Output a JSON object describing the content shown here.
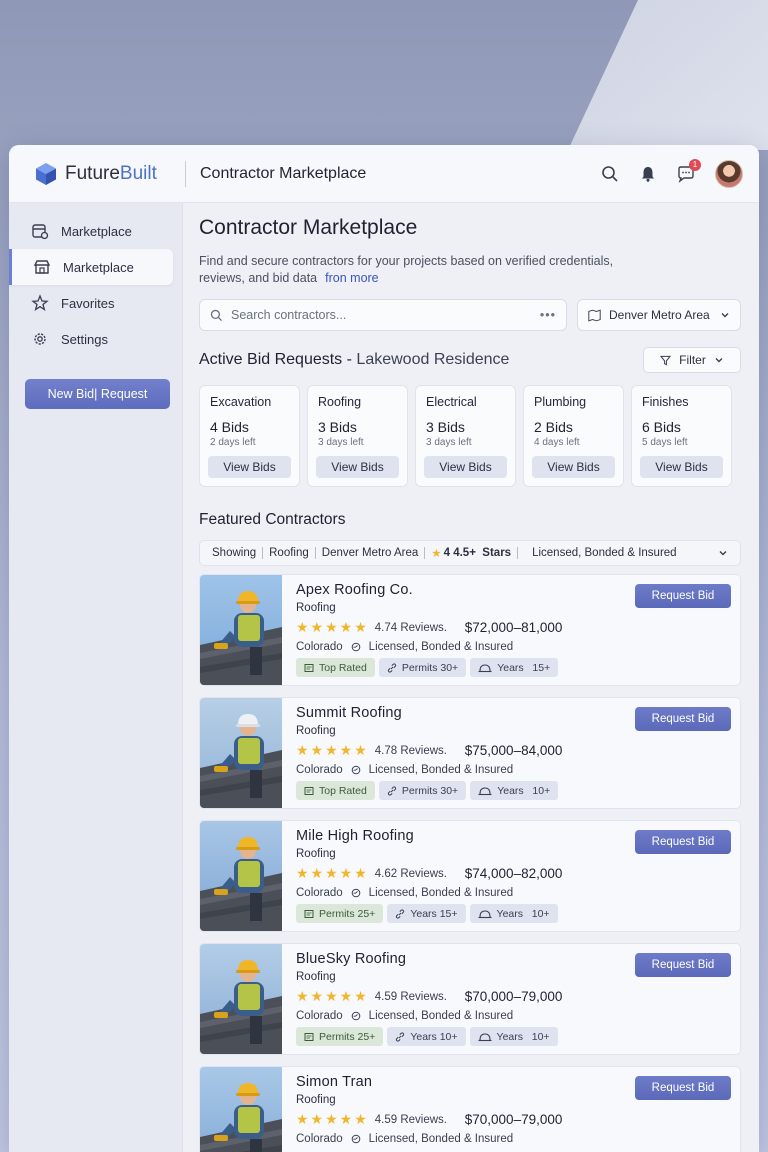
{
  "brand": {
    "name_part1": "Future",
    "name_part2": "Built"
  },
  "header": {
    "title": "Contractor Marketplace",
    "notification_count": "1"
  },
  "sidebar": {
    "items": [
      {
        "label": "Marketplace",
        "icon": "marketplace-icon",
        "active": false
      },
      {
        "label": "Marketplace",
        "icon": "store-icon",
        "active": true
      },
      {
        "label": "Favorites",
        "icon": "star-icon",
        "active": false
      },
      {
        "label": "Settings",
        "icon": "gear-icon",
        "active": false
      }
    ],
    "new_button": "New Bid| Request"
  },
  "main": {
    "title": "Contractor Marketplace",
    "subtitle": "Find and secure contractors for your projects based on verified credentials, reviews, and bid data",
    "more_link": "fron more",
    "search_placeholder": "Search contractors...",
    "location": "Denver Metro Area"
  },
  "bids": {
    "title": "Active Bid Requests",
    "separator": "-",
    "project": "Lakewood Residence",
    "filter_label": "Filter",
    "view_label": "View Bids",
    "cards": [
      {
        "category": "Excavation",
        "count": "4 Bids",
        "days": "2 days left"
      },
      {
        "category": "Roofing",
        "count": "3 Bids",
        "days": "3 days left"
      },
      {
        "category": "Electrical",
        "count": "3 Bids",
        "days": "3 days left"
      },
      {
        "category": "Plumbing",
        "count": "2 Bids",
        "days": "4 days left"
      },
      {
        "category": "Finishes",
        "count": "6 Bids",
        "days": "5 days left"
      }
    ]
  },
  "featured": {
    "title": "Featured Contractors",
    "filter": {
      "showing": "Showing",
      "trade": "Roofing",
      "area": "Denver Metro Area",
      "stars_prefix": "4",
      "stars_label": "4.5+",
      "stars_word": "Stars",
      "license": "Licensed, Bonded & Insured"
    },
    "request_label": "Request Bid",
    "stars": "★★★★★",
    "contractors": [
      {
        "name": "Apex Roofing Co.",
        "trade": "Roofing",
        "rating": "4.74 Reviews.",
        "price": "$72,000–81,000",
        "state": "Colorado",
        "license": "Licensed, Bonded & Insured",
        "tags": [
          {
            "label": "Top Rated",
            "style": "green",
            "icon": "certificate-icon"
          },
          {
            "label": "Permits 30+",
            "style": "blue",
            "icon": "link-icon"
          },
          {
            "label": "Years   15+",
            "style": "blue",
            "icon": "hardhat-icon"
          }
        ]
      },
      {
        "name": "Summit Roofing",
        "trade": "Roofing",
        "rating": "4.78 Reviews.",
        "price": "$75,000–84,000",
        "state": "Colorado",
        "license": "Licensed, Bonded & Insured",
        "tags": [
          {
            "label": "Top Rated",
            "style": "green",
            "icon": "certificate-icon"
          },
          {
            "label": "Permits 30+",
            "style": "blue",
            "icon": "link-icon"
          },
          {
            "label": "Years   10+",
            "style": "blue",
            "icon": "hardhat-icon"
          }
        ]
      },
      {
        "name": "Mile High Roofing",
        "trade": "Roofing",
        "rating": "4.62 Reviews.",
        "price": "$74,000–82,000",
        "state": "Colorado",
        "license": "Licensed, Bonded & Insured",
        "tags": [
          {
            "label": "Permits 25+",
            "style": "green",
            "icon": "certificate-icon"
          },
          {
            "label": "Years 15+",
            "style": "blue",
            "icon": "link-icon"
          },
          {
            "label": "Years   10+",
            "style": "blue",
            "icon": "hardhat-icon"
          }
        ]
      },
      {
        "name": "BlueSky Roofing",
        "trade": "Roofing",
        "rating": "4.59 Reviews.",
        "price": "$70,000–79,000",
        "state": "Colorado",
        "license": "Licensed, Bonded & Insured",
        "tags": [
          {
            "label": "Permits 25+",
            "style": "green",
            "icon": "certificate-icon"
          },
          {
            "label": "Years 10+",
            "style": "blue",
            "icon": "link-icon"
          },
          {
            "label": "Years   10+",
            "style": "blue",
            "icon": "hardhat-icon"
          }
        ]
      },
      {
        "name": "Simon Tran",
        "trade": "Roofing",
        "rating": "4.59 Reviews.",
        "price": "$70,000–79,000",
        "state": "Colorado",
        "license": "Licensed, Bonded & Insured",
        "tags": []
      }
    ]
  },
  "colors": {
    "accent": "#5d6cbd",
    "star": "#f2b62c",
    "badge": "#e04a55"
  }
}
